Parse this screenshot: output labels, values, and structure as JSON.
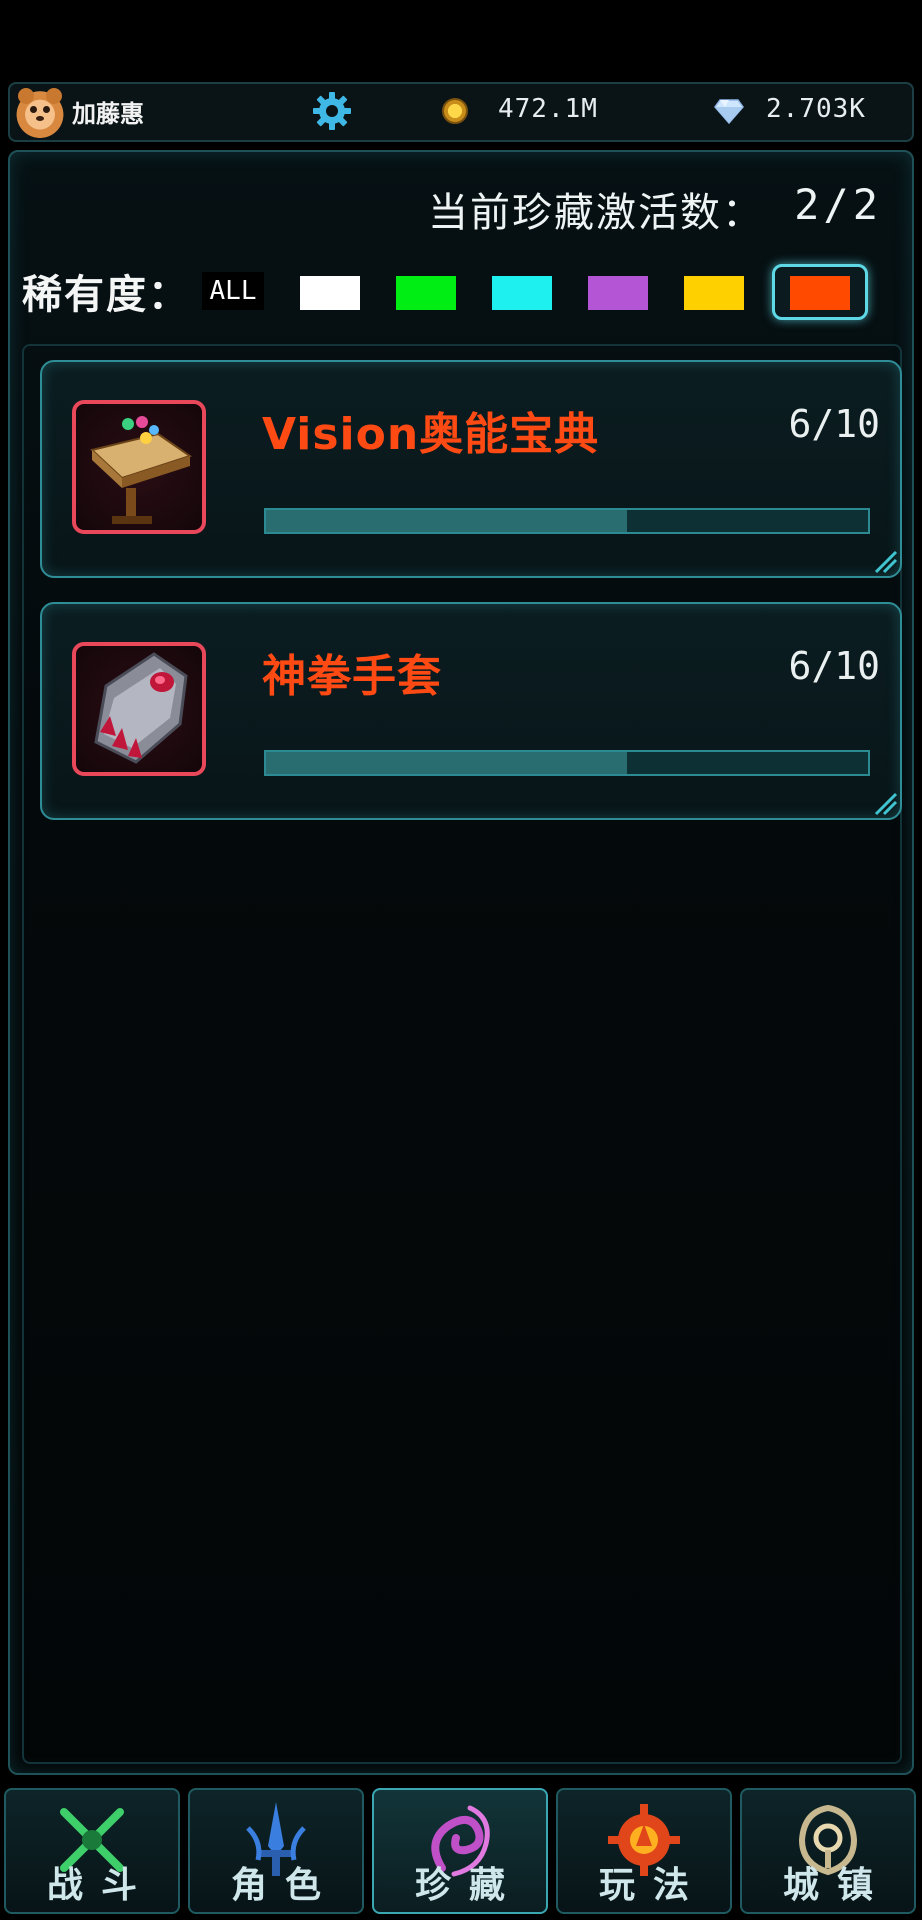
{
  "header": {
    "username": "加藤惠",
    "gold": "472.1M",
    "diamonds": "2.703K"
  },
  "collection": {
    "active_label": "当前珍藏激活数：",
    "active_value": "2/2",
    "rarity_label": "稀有度：",
    "rarity_all": "ALL",
    "rarity_colors": [
      "#ffffff",
      "#00ee14",
      "#1ef0f0",
      "#b455d6",
      "#ffd000",
      "#ff4a00"
    ],
    "selected_rarity_color": "#ff4a00"
  },
  "items": [
    {
      "name": "Vision奥能宝典",
      "count": "6/10",
      "progress": 0.6,
      "icon": "book-lectern-icon",
      "rarity_color": "#e8485a"
    },
    {
      "name": "神拳手套",
      "count": "6/10",
      "progress": 0.6,
      "icon": "gauntlet-icon",
      "rarity_color": "#e8485a"
    }
  ],
  "nav": {
    "tabs": [
      {
        "label": "战斗",
        "icon": "crossed-swords-icon",
        "active": false
      },
      {
        "label": "角色",
        "icon": "sword-character-icon",
        "active": false
      },
      {
        "label": "珍藏",
        "icon": "collection-swirl-icon",
        "active": true
      },
      {
        "label": "玩法",
        "icon": "gameplay-gear-icon",
        "active": false
      },
      {
        "label": "城镇",
        "icon": "town-emblem-icon",
        "active": false
      }
    ]
  }
}
